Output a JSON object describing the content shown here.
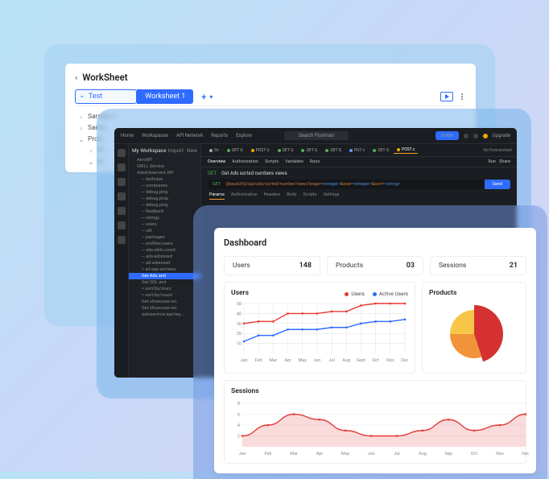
{
  "worksheet": {
    "title": "WorkSheet",
    "tabs": {
      "test": "Test",
      "active": "Worksheet 1"
    },
    "tree": [
      "Sample T...",
      "Samp...",
      "Prod...",
      "Pr...",
      "re..."
    ]
  },
  "ide": {
    "top_nav": [
      "Home",
      "Workspaces",
      "API Network",
      "Reports",
      "Explore"
    ],
    "search_placeholder": "Search Postman",
    "invite_label": "Invite",
    "upgrade_label": "Upgrade",
    "workspace_label": "My Workspace",
    "new_label": "New",
    "import_label": "Import",
    "tabs": [
      {
        "label": "Ov",
        "color": "#aaaaaa"
      },
      {
        "label": "GET G",
        "color": "#4caf50"
      },
      {
        "label": "POST U",
        "color": "#f0a800"
      },
      {
        "label": "GET G",
        "color": "#4caf50"
      },
      {
        "label": "GET G",
        "color": "#4caf50"
      },
      {
        "label": "GET G",
        "color": "#4caf50"
      },
      {
        "label": "PUT c",
        "color": "#5a9bff"
      },
      {
        "label": "GET G",
        "color": "#4caf50"
      },
      {
        "label": "POST c",
        "color": "#f0a800"
      }
    ],
    "env_label": "No Environment",
    "subtabs": [
      "Overview",
      "Authorization",
      "Scripts",
      "Variables",
      "Runs"
    ],
    "subtabs_extra": [
      "Run",
      "Share"
    ],
    "request_title": "Get Ads sorted numbers views",
    "method": "GET",
    "url_parts": {
      "a": "{{baseUrl}}/api/ads/sorted/number/views?page=",
      "b": "<integer>",
      "c": "&size=",
      "d": "<integer>",
      "e": "&sort=",
      "f": "<string>"
    },
    "send_label": "Send",
    "req_tabs": [
      "Params",
      "Authorization",
      "Headers",
      "Body",
      "Scripts",
      "Settings"
    ],
    "sidebar_tree": [
      "AeroMT",
      "GRILL Service",
      "Advertisement API",
      "~ testcase",
      "~ companies",
      "~ debug.ping",
      "~ debug.prop",
      "~ debug.ping",
      "~ feedback",
      "~ ratings",
      "~ users",
      "~ util",
      "~ packages",
      "~ profiles/users",
      "~ ads-skils count",
      "~ ads-adressed",
      "~ ad-adressed",
      "> ad-app-adviews",
      "Get Ads and",
      "Get SQL and",
      "> sort/by/stars",
      "> sort/by/count",
      "Get showcase-rec",
      "Get showcase-rec",
      "autoservice/api/req..."
    ]
  },
  "dashboard": {
    "title": "Dashboard",
    "metrics": [
      {
        "label": "Users",
        "value": "148"
      },
      {
        "label": "Products",
        "value": "03"
      },
      {
        "label": "Sessions",
        "value": "21"
      }
    ],
    "users_chart_title": "Users",
    "products_chart_title": "Products",
    "sessions_chart_title": "Sessions",
    "legend": {
      "users": "Users",
      "active": "Active Users"
    }
  },
  "chart_data": [
    {
      "type": "line",
      "title": "Users",
      "categories": [
        "Jan",
        "Feb",
        "Mar",
        "Apr",
        "May",
        "Jun",
        "Jul",
        "Aug",
        "Sept",
        "Oct",
        "Nov",
        "Dec"
      ],
      "series": [
        {
          "name": "Users",
          "color": "#e53935",
          "values": [
            30,
            32,
            32,
            40,
            40,
            40,
            42,
            42,
            48,
            50,
            50,
            50
          ]
        },
        {
          "name": "Active Users",
          "color": "#2f6bff",
          "values": [
            12,
            18,
            18,
            24,
            24,
            24,
            26,
            26,
            30,
            32,
            32,
            34
          ]
        }
      ],
      "ylim": [
        0,
        50
      ],
      "yticks": [
        10,
        20,
        30,
        40,
        50
      ]
    },
    {
      "type": "pie",
      "title": "Products",
      "slices": [
        {
          "value": 45,
          "color": "#d32020"
        },
        {
          "value": 30,
          "color": "#f08a28"
        },
        {
          "value": 25,
          "color": "#f6c13a"
        }
      ]
    },
    {
      "type": "area",
      "title": "Sessions",
      "categories": [
        "Jan",
        "Feb",
        "Mar",
        "Apr",
        "May",
        "Jun",
        "Jul",
        "Aug",
        "Sep",
        "Oct",
        "Nov",
        "Dec"
      ],
      "values": [
        2,
        4,
        6,
        5,
        3,
        2,
        2,
        3,
        5,
        3,
        4,
        6
      ],
      "ylim": [
        0,
        8
      ],
      "yticks": [
        2,
        4,
        6,
        8
      ],
      "color": "#e53935"
    }
  ]
}
